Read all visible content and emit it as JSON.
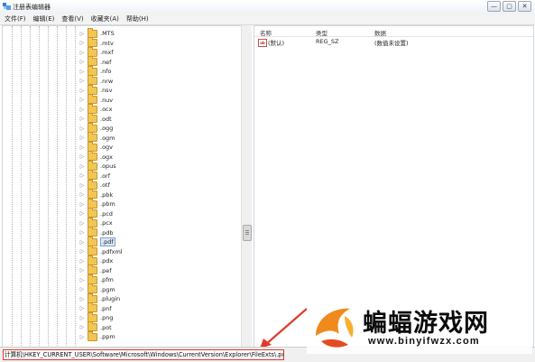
{
  "window": {
    "title": "注册表编辑器",
    "buttons": {
      "minimize": "—",
      "maximize": "▢",
      "close": "✕"
    }
  },
  "menu": [
    "文件(F)",
    "编辑(E)",
    "查看(V)",
    "收藏夹(A)",
    "帮助(H)"
  ],
  "tree": {
    "items": [
      ".MTS",
      ".mtv",
      ".mxf",
      ".nef",
      ".nfo",
      ".nrw",
      ".nsv",
      ".nuv",
      ".ocx",
      ".odt",
      ".ogg",
      ".ogm",
      ".ogv",
      ".ogx",
      ".opus",
      ".orf",
      ".otf",
      ".pbk",
      ".pbm",
      ".pcd",
      ".pcx",
      ".pdb",
      ".pdf",
      ".pdfxml",
      ".pdx",
      ".pef",
      ".pfm",
      ".pgm",
      ".plugin",
      ".pnf",
      ".png",
      ".pot",
      ".ppm"
    ],
    "selected": ".pdf"
  },
  "values": {
    "headers": {
      "name": "名称",
      "type": "类型",
      "data": "数据"
    },
    "rows": [
      {
        "name": "(默认)",
        "type": "REG_SZ",
        "data": "(数值未设置)",
        "icon": "ab"
      }
    ]
  },
  "status": {
    "path": "计算机\\HKEY_CURRENT_USER\\Software\\Microsoft\\Windows\\CurrentVersion\\Explorer\\FileExts\\.pdf"
  },
  "watermark": {
    "text": "蝙蝠游戏网",
    "url": "www.binyifwzx.com"
  },
  "colors": {
    "highlight_border": "#e23a2a",
    "folder": "#f3c552",
    "selection": "#dbe9f9"
  }
}
